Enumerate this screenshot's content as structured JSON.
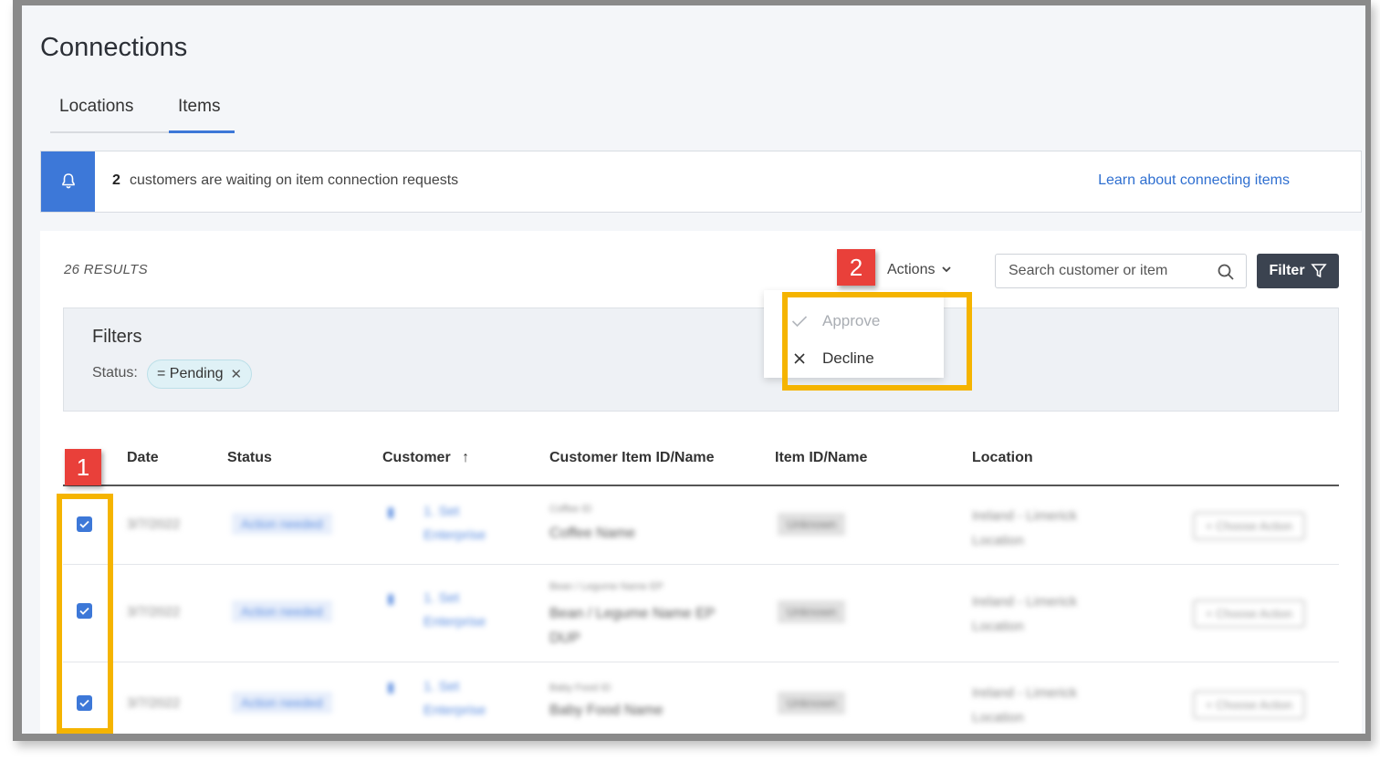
{
  "page": {
    "title": "Connections"
  },
  "tabs": [
    {
      "label": "Locations"
    },
    {
      "label": "Items"
    }
  ],
  "banner": {
    "count": "2",
    "message": "customers are waiting on item connection requests",
    "link": "Learn about connecting items",
    "icon": "bell-icon"
  },
  "toolbar": {
    "results": "26 RESULTS",
    "actions_label": "Actions",
    "search_placeholder": "Search customer or item",
    "filter_label": "Filter"
  },
  "filters": {
    "title": "Filters",
    "status_label": "Status:",
    "chip": "= Pending"
  },
  "table": {
    "headers": [
      "Date",
      "Status",
      "Customer",
      "Customer Item ID/Name",
      "Item ID/Name",
      "Location"
    ],
    "sort_indicator": "↑",
    "rows": [
      {
        "date": "3/7/2022",
        "status": "Action needed",
        "customer_line1": "1. Set",
        "customer_line2": "Enterprise",
        "item_id_small": "Coffee ID",
        "item_name": "Coffee Name",
        "item_name_line2": "",
        "item": "Unknown",
        "location_line1": "Ireland - Limerick",
        "location_line2": "Location",
        "action": "+ Choose Action"
      },
      {
        "date": "3/7/2022",
        "status": "Action needed",
        "customer_line1": "1. Set",
        "customer_line2": "Enterprise",
        "item_id_small": "Bean / Legume Name EP",
        "item_name": "Bean / Legume Name EP",
        "item_name_line2": "DUP",
        "item": "Unknown",
        "location_line1": "Ireland - Limerick",
        "location_line2": "Location",
        "action": "+ Choose Action"
      },
      {
        "date": "3/7/2022",
        "status": "Action needed",
        "customer_line1": "1. Set",
        "customer_line2": "Enterprise",
        "item_id_small": "Baby Food ID",
        "item_name": "Baby Food Name",
        "item_name_line2": "",
        "item": "Unknown",
        "location_line1": "Ireland - Limerick",
        "location_line2": "Location",
        "action": "+ Choose Action"
      }
    ]
  },
  "actions_menu": [
    {
      "label": "Approve",
      "icon": "check-icon",
      "disabled": true
    },
    {
      "label": "Decline",
      "icon": "x-icon",
      "disabled": false
    }
  ],
  "callouts": [
    "1",
    "2"
  ],
  "colors": {
    "accent": "#3d78d8",
    "highlight": "#f5b400",
    "callout": "#e9403a",
    "filter_button": "#3b4350"
  }
}
